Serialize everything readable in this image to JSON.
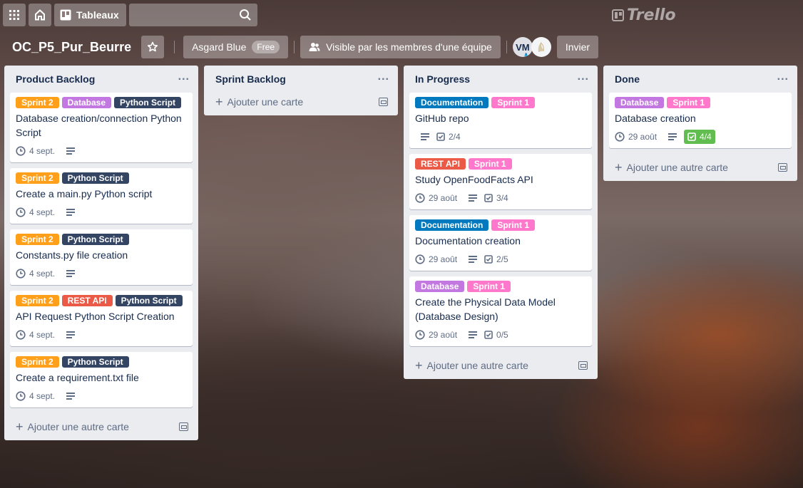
{
  "topbar": {
    "apps_icon": "grid-icon",
    "home_icon": "home-icon",
    "boards_label": "Tableaux",
    "search_value": "",
    "logo_text": "Trello"
  },
  "board": {
    "title": "OC_P5_Pur_Beurre",
    "team_name": "Asgard Blue",
    "plan_badge": "Free",
    "visibility": "Visible par les membres d'une équipe",
    "member_initials": "VM",
    "invite_label": "Invier"
  },
  "colors": {
    "sprint2": "#ff9f1a",
    "database": "#c377e0",
    "python": "#344563",
    "rest": "#eb5a46",
    "documentation": "#0079bf",
    "sprint1": "#ff78cb",
    "complete": "#61bd4f"
  },
  "lists": [
    {
      "title": "Product Backlog",
      "add_label": "Ajouter une autre carte",
      "cards": [
        {
          "labels": [
            {
              "text": "Sprint 2",
              "color": "sprint2"
            },
            {
              "text": "Database",
              "color": "database"
            },
            {
              "text": "Python Script",
              "color": "python"
            }
          ],
          "title": "Database creation/connection Python Script",
          "due": "4 sept.",
          "desc": true,
          "checklist": null
        },
        {
          "labels": [
            {
              "text": "Sprint 2",
              "color": "sprint2"
            },
            {
              "text": "Python Script",
              "color": "python"
            }
          ],
          "title": "Create a main.py Python script",
          "due": "4 sept.",
          "desc": true,
          "checklist": null
        },
        {
          "labels": [
            {
              "text": "Sprint 2",
              "color": "sprint2"
            },
            {
              "text": "Python Script",
              "color": "python"
            }
          ],
          "title": "Constants.py file creation",
          "due": "4 sept.",
          "desc": true,
          "checklist": null
        },
        {
          "labels": [
            {
              "text": "Sprint 2",
              "color": "sprint2"
            },
            {
              "text": "REST API",
              "color": "rest"
            },
            {
              "text": "Python Script",
              "color": "python"
            }
          ],
          "title": "API Request Python Script Creation",
          "due": "4 sept.",
          "desc": true,
          "checklist": null
        },
        {
          "labels": [
            {
              "text": "Sprint 2",
              "color": "sprint2"
            },
            {
              "text": "Python Script",
              "color": "python"
            }
          ],
          "title": "Create a requirement.txt file",
          "due": "4 sept.",
          "desc": true,
          "checklist": null
        }
      ]
    },
    {
      "title": "Sprint Backlog",
      "add_label": "Ajouter une carte",
      "cards": []
    },
    {
      "title": "In Progress",
      "add_label": "Ajouter une autre carte",
      "cards": [
        {
          "labels": [
            {
              "text": "Documentation",
              "color": "documentation"
            },
            {
              "text": "Sprint 1",
              "color": "sprint1"
            }
          ],
          "title": "GitHub repo",
          "due": null,
          "desc": true,
          "checklist": "2/4",
          "complete": false
        },
        {
          "labels": [
            {
              "text": "REST API",
              "color": "rest"
            },
            {
              "text": "Sprint 1",
              "color": "sprint1"
            }
          ],
          "title": "Study OpenFoodFacts API",
          "due": "29 août",
          "desc": true,
          "checklist": "3/4",
          "complete": false
        },
        {
          "labels": [
            {
              "text": "Documentation",
              "color": "documentation"
            },
            {
              "text": "Sprint 1",
              "color": "sprint1"
            }
          ],
          "title": "Documentation creation",
          "due": "29 août",
          "desc": true,
          "checklist": "2/5",
          "complete": false
        },
        {
          "labels": [
            {
              "text": "Database",
              "color": "database"
            },
            {
              "text": "Sprint 1",
              "color": "sprint1"
            }
          ],
          "title": "Create the Physical Data Model (Database Design)",
          "due": "29 août",
          "desc": true,
          "checklist": "0/5",
          "complete": false
        }
      ]
    },
    {
      "title": "Done",
      "add_label": "Ajouter une autre carte",
      "cards": [
        {
          "labels": [
            {
              "text": "Database",
              "color": "database"
            },
            {
              "text": "Sprint 1",
              "color": "sprint1"
            }
          ],
          "title": "Database creation",
          "due": "29 août",
          "desc": true,
          "checklist": "4/4",
          "complete": true
        }
      ]
    }
  ]
}
